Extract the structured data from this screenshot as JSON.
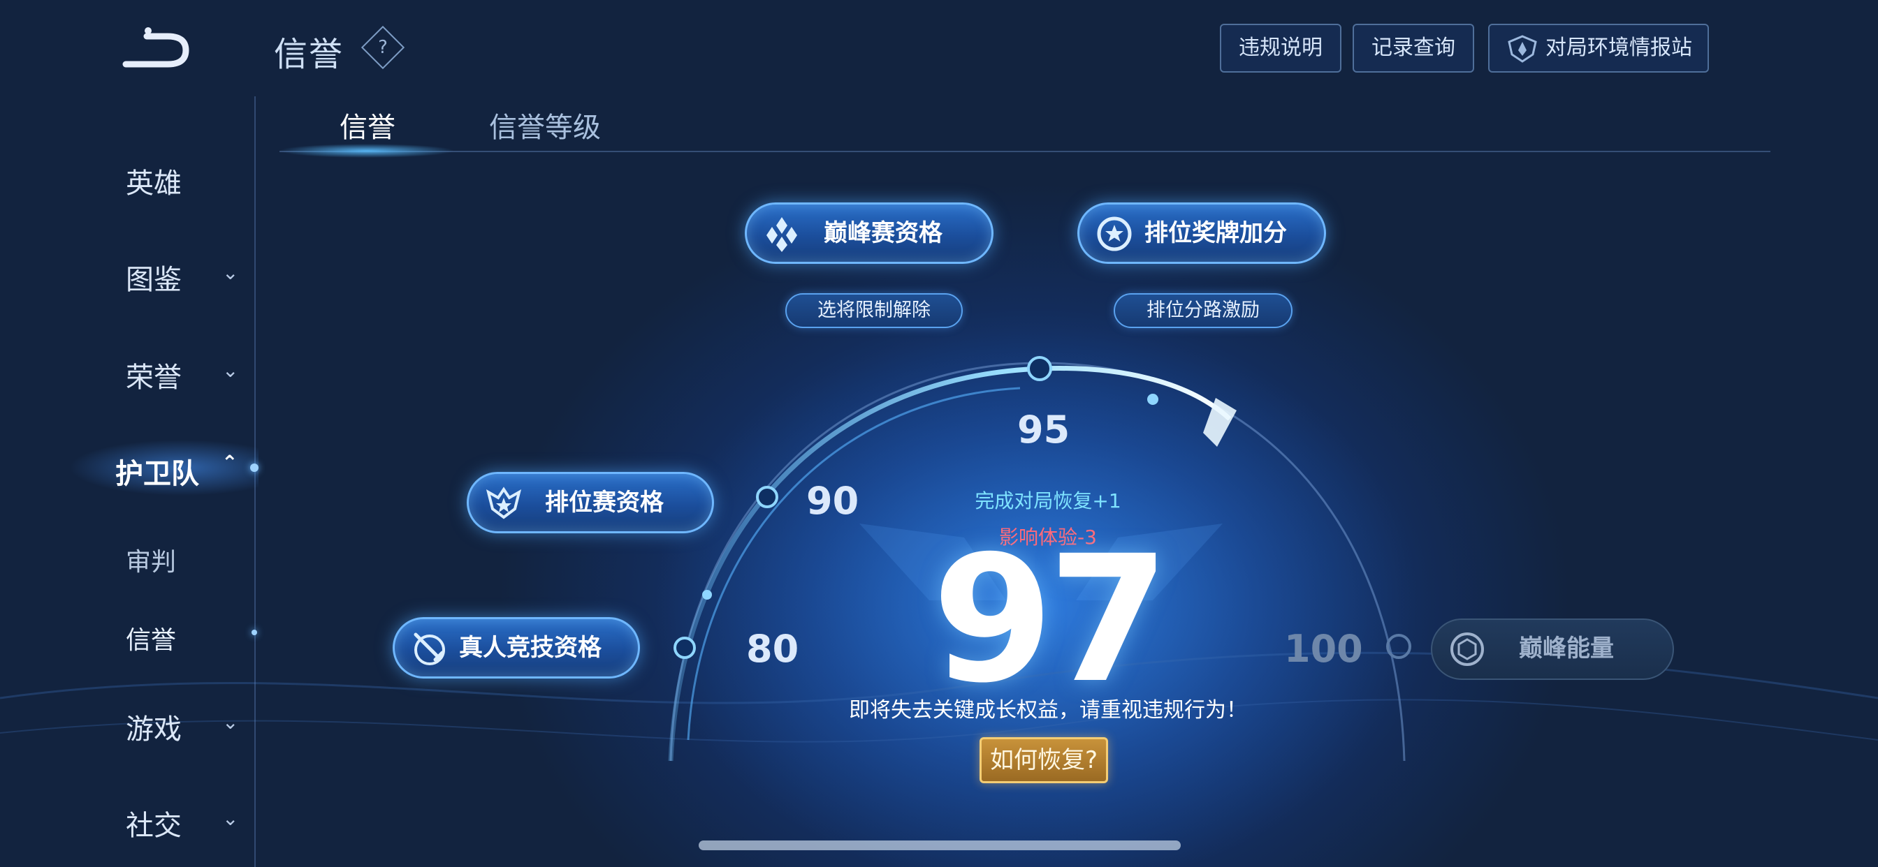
{
  "header": {
    "title": "信誉",
    "help_symbol": "?",
    "buttons": [
      "违规说明",
      "记录查询",
      "对局环境情报站"
    ]
  },
  "sidebar": {
    "items": [
      {
        "label": "英雄",
        "chevron": false
      },
      {
        "label": "图鉴",
        "chevron": true
      },
      {
        "label": "荣誉",
        "chevron": true
      },
      {
        "label": "护卫队",
        "chevron": true,
        "expanded": true,
        "active": true
      },
      {
        "label": "审判",
        "sub": true
      },
      {
        "label": "信誉",
        "sub": true,
        "selected": true
      },
      {
        "label": "游戏",
        "chevron": true
      },
      {
        "label": "社交",
        "chevron": true
      }
    ]
  },
  "tabs": [
    {
      "label": "信誉",
      "active": true
    },
    {
      "label": "信誉等级",
      "active": false
    }
  ],
  "benefits": {
    "peak_qualification": "巅峰赛资格",
    "hero_pick_unlock": "选将限制解除",
    "rank_medal_bonus": "排位奖牌加分",
    "rank_lane_incentive": "排位分路激励",
    "ranked_qualification": "排位赛资格",
    "real_player_qualification": "真人竞技资格",
    "peak_energy": "巅峰能量"
  },
  "ticks": {
    "t80": "80",
    "t90": "90",
    "t95": "95",
    "t100": "100"
  },
  "score": {
    "value": "97",
    "recover_per_match": "完成对局恢复+1",
    "experience_penalty": "影响体验-3",
    "warning": "即将失去关键成长权益，请重视违规行为！",
    "recover_button": "如何恢复?"
  },
  "colors": {
    "accent": "#6fb7ff",
    "recover": "#7fe3ff",
    "penalty": "#ff6a7a",
    "gold": "#c8923a"
  }
}
